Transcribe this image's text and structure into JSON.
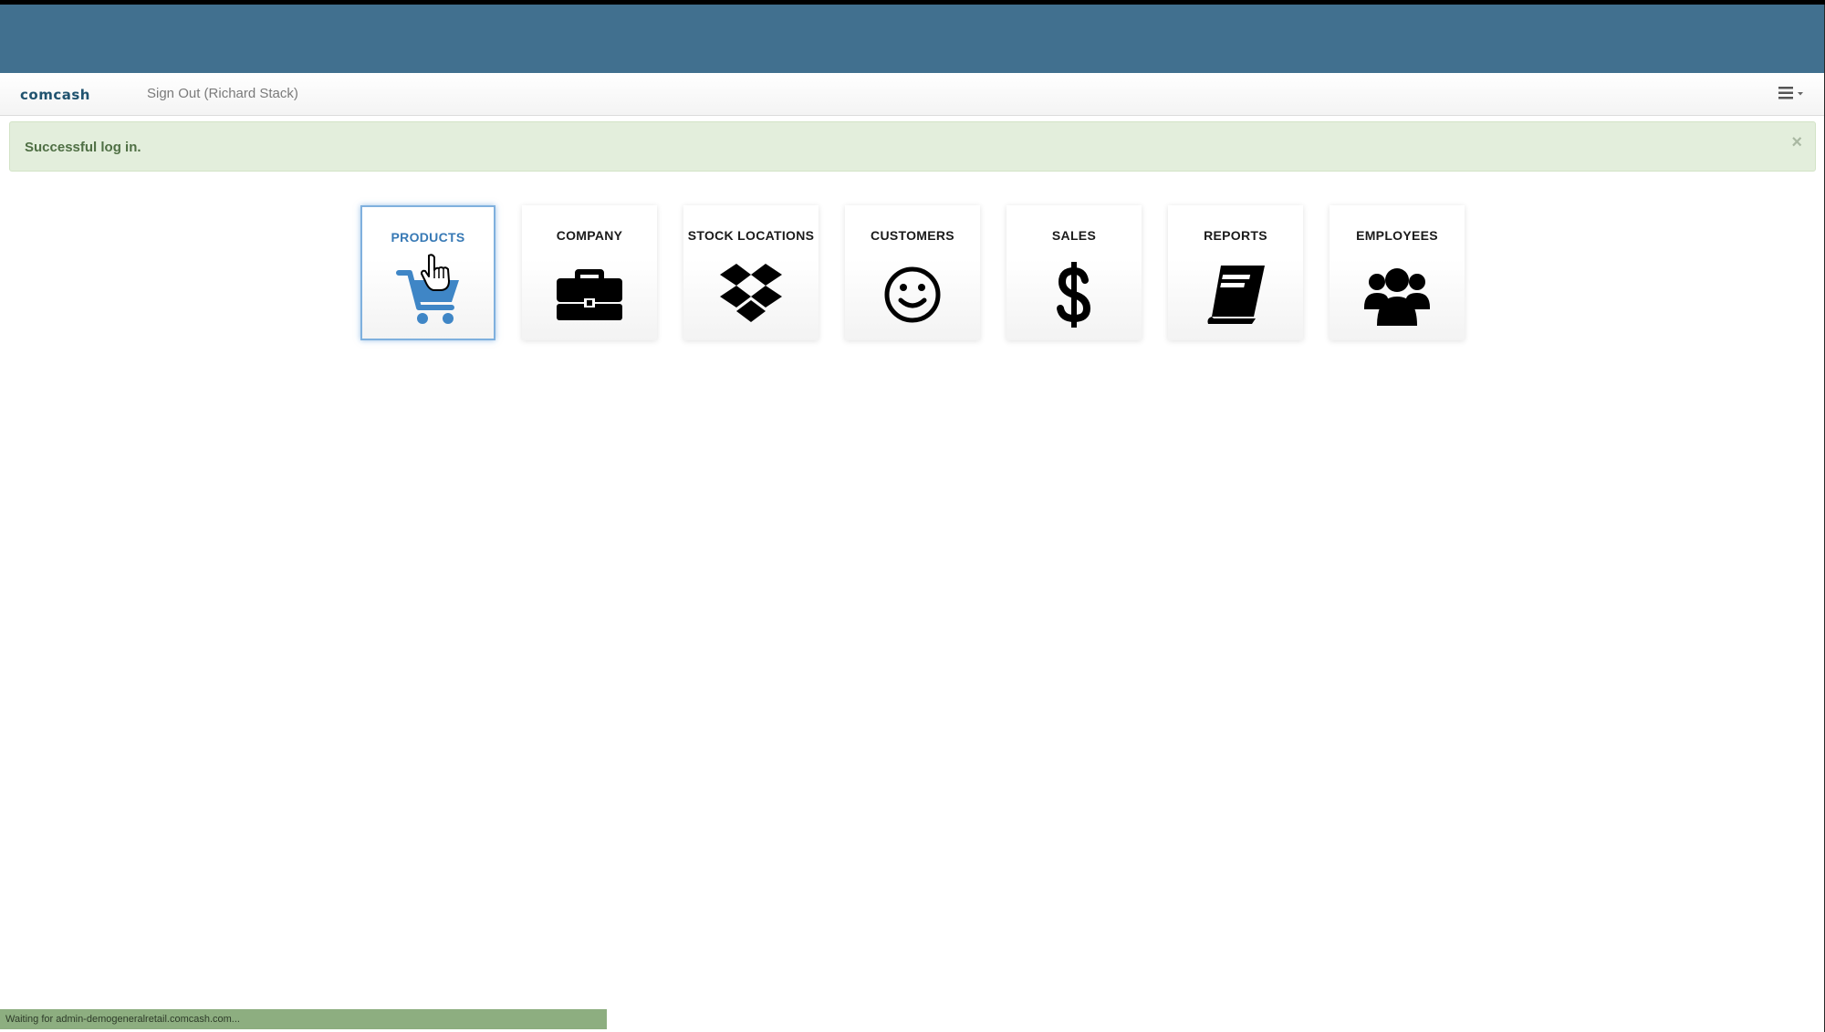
{
  "app": {
    "brand": "comcash",
    "sign_out_label": "Sign Out (Richard Stack)",
    "menu_icon": "hamburger-menu-icon"
  },
  "alert": {
    "message": "Successful log in.",
    "close_label": "×"
  },
  "tiles": [
    {
      "label": "PRODUCTS",
      "icon": "shopping-cart-icon",
      "active": true
    },
    {
      "label": "COMPANY",
      "icon": "briefcase-icon",
      "active": false
    },
    {
      "label": "STOCK LOCATIONS",
      "icon": "dropbox-icon",
      "active": false
    },
    {
      "label": "CUSTOMERS",
      "icon": "smiley-icon",
      "active": false
    },
    {
      "label": "SALES",
      "icon": "dollar-icon",
      "active": false
    },
    {
      "label": "REPORTS",
      "icon": "book-icon",
      "active": false
    },
    {
      "label": "EMPLOYEES",
      "icon": "users-icon",
      "active": false
    }
  ],
  "status_bar": {
    "text": "Waiting for admin-demogeneralretail.comcash.com..."
  },
  "colors": {
    "header_band": "#41708f",
    "brand": "#20536f",
    "alert_bg": "#e3eedc",
    "active_accent": "#3779b5",
    "status_bar": "#8dae80"
  }
}
